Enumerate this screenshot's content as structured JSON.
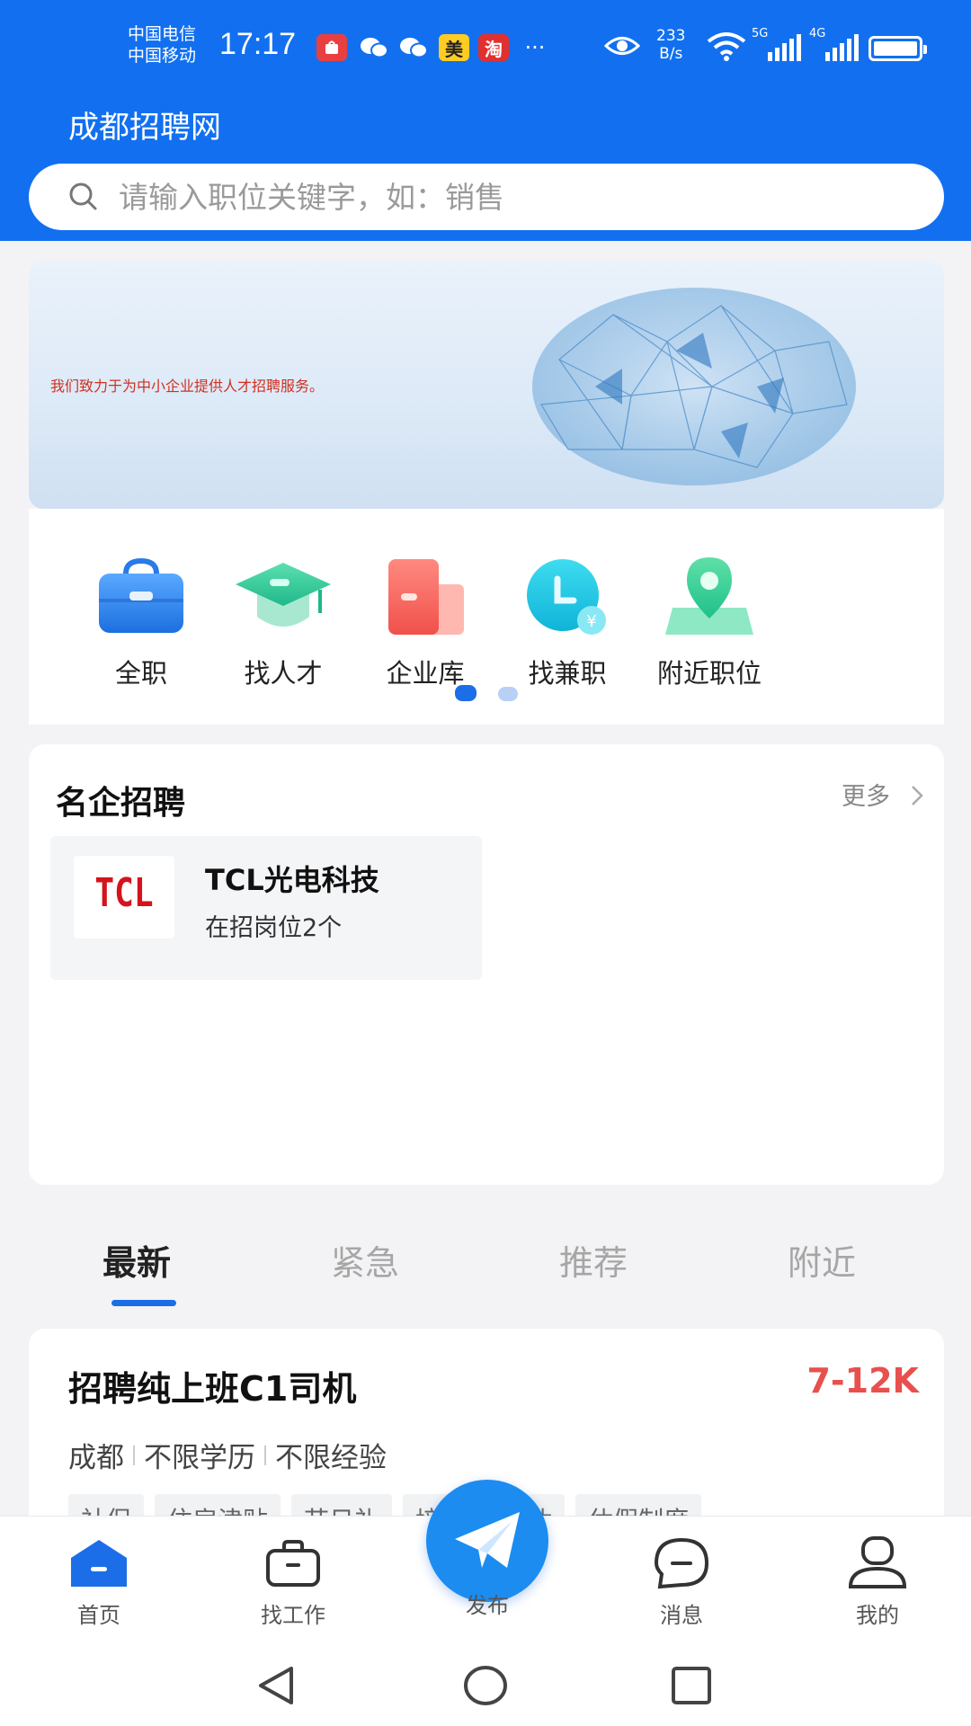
{
  "status_bar": {
    "carrier_1": "中国电信",
    "carrier_2": "中国移动",
    "time": "17:17",
    "notif_mei": "美",
    "notif_tao": "淘",
    "notif_more": "···",
    "net_speed_value": "233",
    "net_speed_unit": "B/s",
    "sig1_label": "5G",
    "sig2_label": "4G"
  },
  "header": {
    "app_title": "成都招聘网",
    "search_placeholder": "请输入职位关键字，如：销售"
  },
  "banner": {
    "text": "我们致力于为中小企业提供人才招聘服务。"
  },
  "categories": [
    {
      "label": "全职",
      "icon": "briefcase-icon"
    },
    {
      "label": "找人才",
      "icon": "graduation-cap-icon"
    },
    {
      "label": "企业库",
      "icon": "company-icon"
    },
    {
      "label": "找兼职",
      "icon": "part-time-clock-icon"
    },
    {
      "label": "附近职位",
      "icon": "location-pin-icon"
    }
  ],
  "famous": {
    "title": "名企招聘",
    "more": "更多",
    "company": {
      "logo_text": "TCL",
      "name": "TCL光电科技",
      "positions": "在招岗位2个"
    }
  },
  "tabs": [
    {
      "label": "最新",
      "active": true
    },
    {
      "label": "紧急",
      "active": false
    },
    {
      "label": "推荐",
      "active": false
    },
    {
      "label": "附近",
      "active": false
    }
  ],
  "job": {
    "title": "招聘纯上班C1司机",
    "salary": "7-12K",
    "location": "成都",
    "education": "不限学历",
    "experience": "不限经验",
    "tags": [
      "社保",
      "住房津贴",
      "节日礼",
      "培训",
      "单休",
      "休假制度"
    ]
  },
  "bottom_nav": {
    "home": "首页",
    "find_job": "找工作",
    "publish": "发布",
    "messages": "消息",
    "mine": "我的"
  },
  "colors": {
    "brand_blue": "#1270f0",
    "salary_red": "#e8504e",
    "active_blue": "#1b6ee8"
  }
}
